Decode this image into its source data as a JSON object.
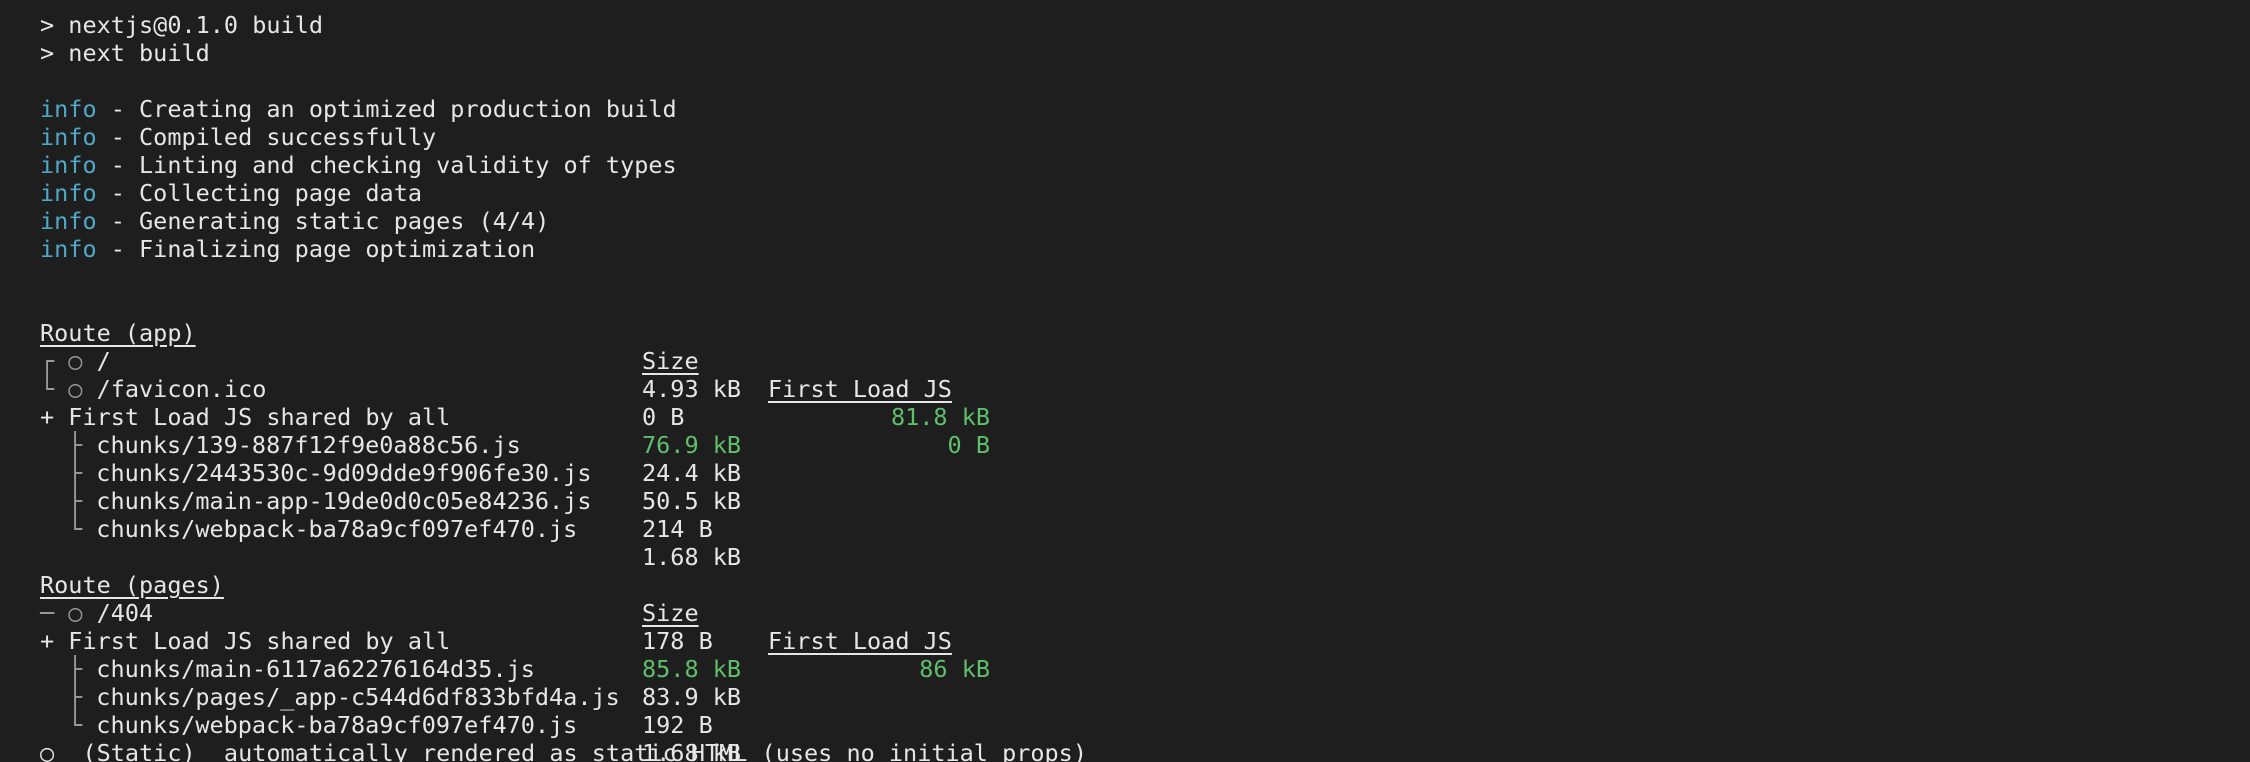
{
  "command_lines": [
    "> nextjs@0.1.0 build",
    "> next build"
  ],
  "info_label": "info",
  "info_lines": [
    " - Creating an optimized production build",
    " - Compiled successfully",
    " - Linting and checking validity of types",
    " - Collecting page data",
    " - Generating static pages (4/4)",
    " - Finalizing page optimization"
  ],
  "app_table": {
    "route_header": "Route (app)",
    "size_header": "Size",
    "first_load_header": "First Load JS",
    "rows": [
      {
        "prefix": "┌ ○ ",
        "route": "/",
        "size": "4.93 kB",
        "first_load": "81.8 kB"
      },
      {
        "prefix": "└ ○ ",
        "route": "/favicon.ico",
        "size": "0 B",
        "first_load": "0 B"
      }
    ],
    "shared": {
      "label": "+ First Load JS shared by all",
      "size": "76.9 kB"
    },
    "chunks": [
      {
        "prefix": "├ ",
        "name": "chunks/139-887f12f9e0a88c56.js",
        "size": "24.4 kB"
      },
      {
        "prefix": "├ ",
        "name": "chunks/2443530c-9d09dde9f906fe30.js",
        "size": "50.5 kB"
      },
      {
        "prefix": "├ ",
        "name": "chunks/main-app-19de0d0c05e84236.js",
        "size": "214 B"
      },
      {
        "prefix": "└ ",
        "name": "chunks/webpack-ba78a9cf097ef470.js",
        "size": "1.68 kB"
      }
    ]
  },
  "pages_table": {
    "route_header": "Route (pages)",
    "size_header": "Size",
    "first_load_header": "First Load JS",
    "rows": [
      {
        "prefix": "─ ○ ",
        "route": "/404",
        "size": "178 B",
        "first_load": "86 kB"
      }
    ],
    "shared": {
      "label": "+ First Load JS shared by all",
      "size": "85.8 kB"
    },
    "chunks": [
      {
        "prefix": "├ ",
        "name": "chunks/main-6117a62276164d35.js",
        "size": "83.9 kB"
      },
      {
        "prefix": "├ ",
        "name": "chunks/pages/_app-c544d6df833bfd4a.js",
        "size": "192 B"
      },
      {
        "prefix": "└ ",
        "name": "chunks/webpack-ba78a9cf097ef470.js",
        "size": "1.68 kB"
      }
    ]
  },
  "legend_line": "○  (Static)  automatically rendered as static HTML (uses no initial props)",
  "colors": {
    "background": "#1e1e1e",
    "text": "#e6e6e6",
    "info": "#4fa8c8",
    "size_green": "#5fbf6a"
  }
}
